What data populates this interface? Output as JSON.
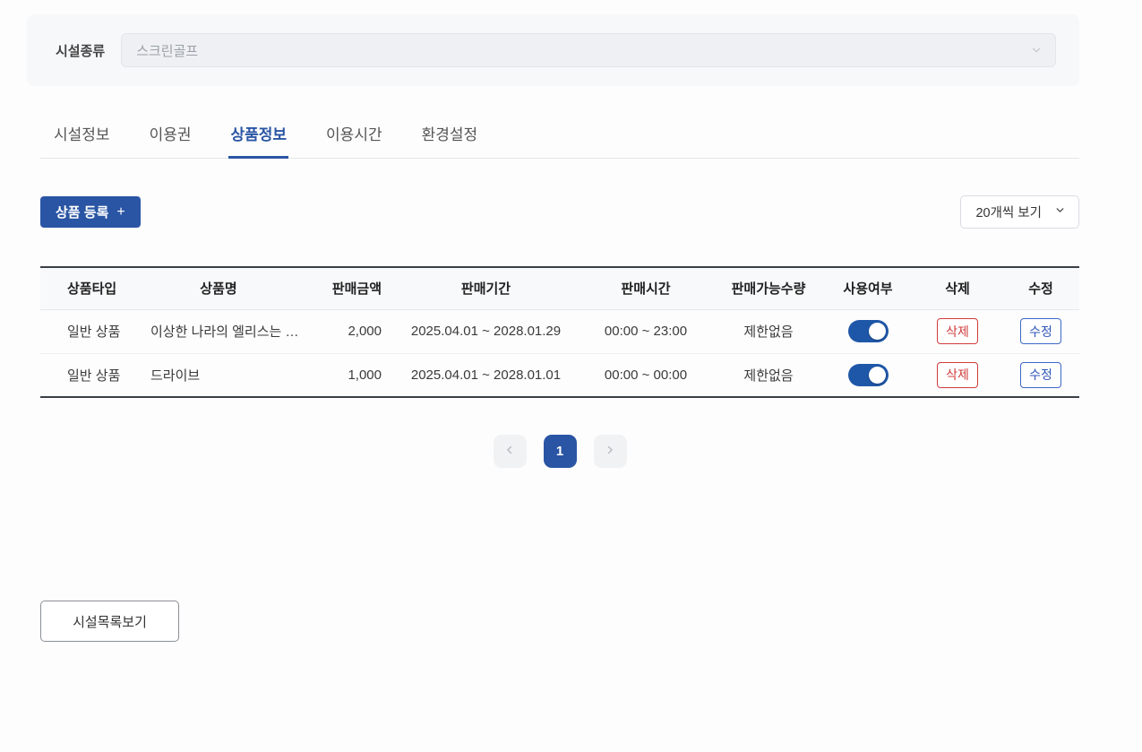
{
  "facility_type": {
    "label": "시설종류",
    "value": "스크린골프"
  },
  "tabs": [
    {
      "label": "시설정보",
      "active": false
    },
    {
      "label": "이용권",
      "active": false
    },
    {
      "label": "상품정보",
      "active": true
    },
    {
      "label": "이용시간",
      "active": false
    },
    {
      "label": "환경설정",
      "active": false
    }
  ],
  "toolbar": {
    "register_label": "상품 등록",
    "plus": "+",
    "page_size": "20개씩 보기"
  },
  "table": {
    "headers": [
      "상품타입",
      "상품명",
      "판매금액",
      "판매기간",
      "판매시간",
      "판매가능수량",
      "사용여부",
      "삭제",
      "수정"
    ],
    "rows": [
      {
        "type": "일반 상품",
        "name": "이상한 나라의 엘리스는 무...",
        "price": "2,000",
        "period": "2025.04.01 ~ 2028.01.29",
        "time": "00:00 ~ 23:00",
        "quantity": "제한없음",
        "enabled": true,
        "delete_label": "삭제",
        "edit_label": "수정"
      },
      {
        "type": "일반 상품",
        "name": "드라이브",
        "price": "1,000",
        "period": "2025.04.01 ~ 2028.01.01",
        "time": "00:00 ~ 00:00",
        "quantity": "제한없음",
        "enabled": true,
        "delete_label": "삭제",
        "edit_label": "수정"
      }
    ]
  },
  "pagination": {
    "current": "1"
  },
  "footer": {
    "facility_list_button": "시설목록보기"
  },
  "colors": {
    "primary_blue": "#2A55A4",
    "danger_red": "#D03C3C",
    "edit_blue": "#3D68C8",
    "toggle_on": "#1F57A8"
  }
}
